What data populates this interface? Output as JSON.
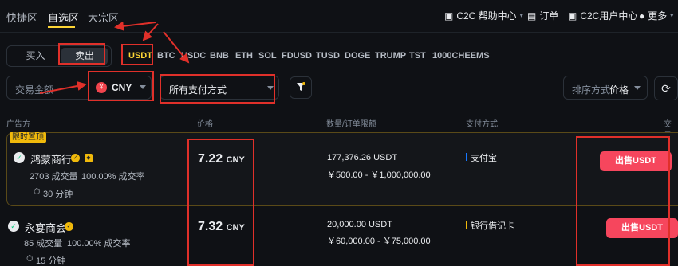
{
  "topnav": {
    "tabs": [
      "快捷区",
      "自选区",
      "大宗区"
    ],
    "c2c_help": "C2C 帮助中心",
    "orders": "订单",
    "c2c_user_center": "C2C用户中心",
    "more": "更多"
  },
  "trade": {
    "buy": "买入",
    "sell": "卖出"
  },
  "coins": [
    "USDT",
    "BTC",
    "USDC",
    "BNB",
    "ETH",
    "SOL",
    "FDUSD",
    "TUSD",
    "DOGE",
    "TRUMP",
    "TST",
    "1000CHEEMS"
  ],
  "filters": {
    "amount_placeholder": "交易金额",
    "currency": "CNY",
    "currency_symbol": "¥",
    "payment": "所有支付方式",
    "sort_label": "排序方式",
    "sort_value": "价格"
  },
  "table": {
    "headers": [
      "广告方",
      "价格",
      "数量/订单限额",
      "支付方式",
      "交易"
    ],
    "pin_tag": "限时置顶",
    "rows": [
      {
        "merchant": "鸿蒙商行",
        "trades": "2703 成交量",
        "completion": "100.00% 成交率",
        "time": "30 分钟",
        "price": "7.22",
        "currency": "CNY",
        "quantity": "177,376.26 USDT",
        "limit": "￥500.00 - ￥1,000,000.00",
        "payment": "支付宝",
        "payment_color": "#1677ff",
        "action": "出售USDT"
      },
      {
        "merchant": "永宴商会",
        "trades": "85 成交量",
        "completion": "100.00% 成交率",
        "time": "15 分钟",
        "price": "7.32",
        "currency": "CNY",
        "quantity": "20,000.00 USDT",
        "limit": "￥60,000.00 - ￥75,000.00",
        "payment": "银行借记卡",
        "payment_color": "#f0b90b",
        "action": "出售USDT"
      }
    ]
  }
}
